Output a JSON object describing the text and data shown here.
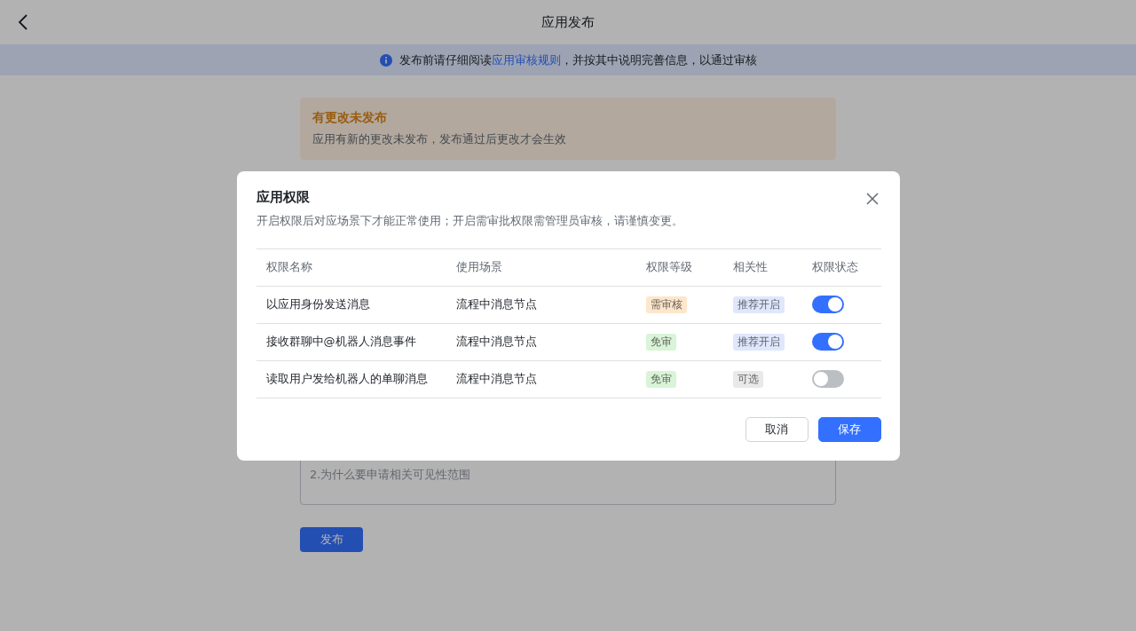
{
  "header": {
    "title": "应用发布"
  },
  "notice": {
    "before": "发布前请仔细阅读",
    "link": "应用审核规则",
    "after": "，并按其中说明完善信息，以通过审核"
  },
  "warning": {
    "title": "有更改未发布",
    "text": "应用有新的更改未发布，发布通过后更改才会生效"
  },
  "reason_field": {
    "placeholder": "2.为什么要申请相关可见性范围"
  },
  "publish_button": "发布",
  "dialog": {
    "title": "应用权限",
    "description": "开启权限后对应场景下才能正常使用；开启需审批权限需管理员审核，请谨慎变更。",
    "columns": [
      "权限名称",
      "使用场景",
      "权限等级",
      "相关性",
      "权限状态"
    ],
    "rows": [
      {
        "name": "以应用身份发送消息",
        "scene": "流程中消息节点",
        "level": {
          "text": "需审核",
          "color": "#fde6cc"
        },
        "relevance": {
          "text": "推荐开启",
          "color": "#dfe7fd"
        },
        "on": true
      },
      {
        "name": "接收群聊中@机器人消息事件",
        "scene": "流程中消息节点",
        "level": {
          "text": "免审",
          "color": "#d9f4d7"
        },
        "relevance": {
          "text": "推荐开启",
          "color": "#dfe7fd"
        },
        "on": true
      },
      {
        "name": "读取用户发给机器人的单聊消息",
        "scene": "流程中消息节点",
        "level": {
          "text": "免审",
          "color": "#d9f4d7"
        },
        "relevance": {
          "text": "可选",
          "color": "#e9e9e9"
        },
        "on": false
      }
    ],
    "buttons": {
      "cancel": "取消",
      "save": "保存"
    }
  }
}
